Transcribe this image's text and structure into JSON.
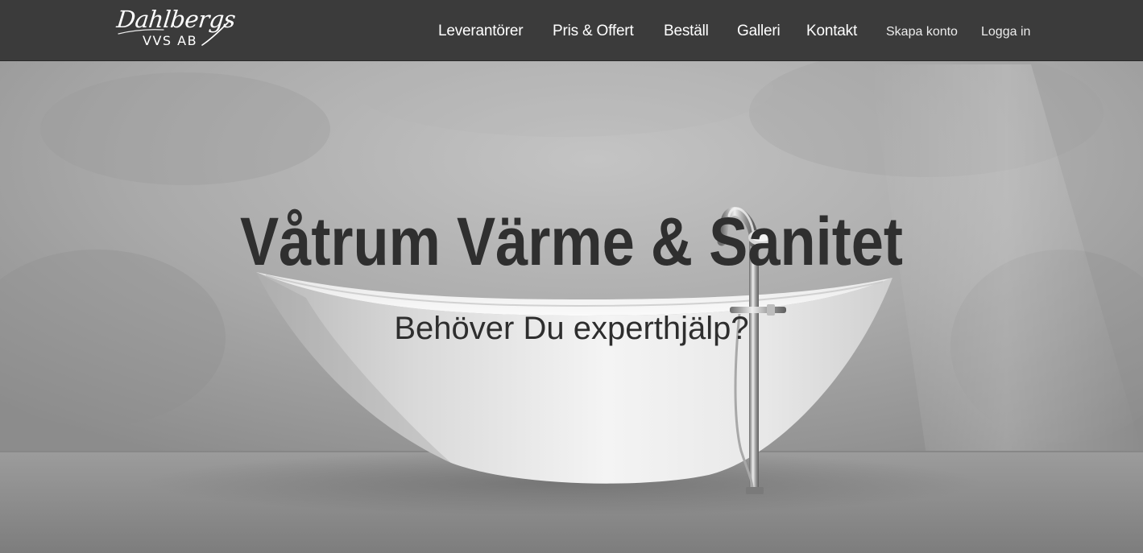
{
  "brand": {
    "script": "Dahlbergs",
    "subtitle": "VVS AB"
  },
  "nav": {
    "primary": [
      {
        "label": "Leverantörer"
      },
      {
        "label": "Pris & Offert"
      },
      {
        "label": "Beställ"
      },
      {
        "label": "Galleri"
      },
      {
        "label": "Kontakt"
      }
    ],
    "account": [
      {
        "label": "Skapa konto"
      },
      {
        "label": "Logga in"
      }
    ]
  },
  "hero": {
    "headline": "Våtrum Värme & Sanitet",
    "subheadline": "Behöver Du experthjälp?"
  },
  "colors": {
    "navbar": "#3b3b3b",
    "nav_text": "#ffffff",
    "headline": "#2f2f2f",
    "wall": "#a8a8a8",
    "floor": "#8a8a8a",
    "tub": "#f2f2f2"
  }
}
